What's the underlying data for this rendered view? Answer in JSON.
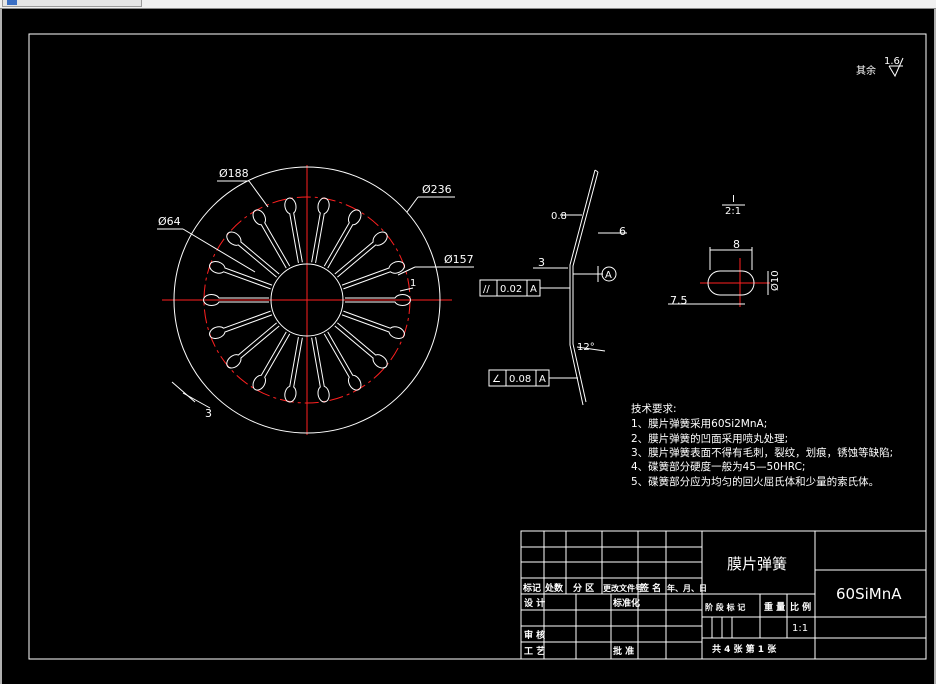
{
  "dims": {
    "d188": "Ø188",
    "d236": "Ø236",
    "d64": "Ø64",
    "d157": "Ø157",
    "n1": "1",
    "n3": "3",
    "sec_t08": "0.8",
    "sec_6": "6",
    "sec_3": "3",
    "sec_12": "12°",
    "detail_8": "8",
    "detail_75": "7.5",
    "detail_10": "Ø10"
  },
  "tolerances": {
    "parallel_symbol": "//",
    "parallel_value": "0.02",
    "parallel_datum": "A",
    "angle_symbol": "∠",
    "angle_value": "0.08",
    "angle_datum": "A",
    "datum_label": "A"
  },
  "detail": {
    "label_top": "I",
    "label_bottom": "2:1"
  },
  "surface": {
    "label": "其余",
    "value": "1.6"
  },
  "notes": {
    "heading": "技术要求:",
    "items": [
      "1、膜片弹簧采用60Si2MnA;",
      "2、膜片弹簧的凹面采用喷丸处理;",
      "3、膜片弹簧表面不得有毛刺，裂纹，划痕，锈蚀等缺陷;",
      "4、碟簧部分硬度一般为45—50HRC;",
      "5、碟簧部分应为均匀的回火屈氏体和少量的索氏体。"
    ]
  },
  "titleblock": {
    "part_name": "膜片弹簧",
    "material": "60SiMnA",
    "h_mark": "标记",
    "h_count": "处数",
    "h_zone": "分 区",
    "h_docno": "更改文件号",
    "h_sign": "签 名",
    "h_date": "年、月、日",
    "design": "设 计",
    "standard": "标准化",
    "review": "审 核",
    "process": "工 艺",
    "approve": "批 准",
    "stage": "阶 段 标 记",
    "weight": "重 量",
    "scale_h": "比 例",
    "scale": "1:1",
    "sheets": "共 4 张  第 1 张"
  }
}
